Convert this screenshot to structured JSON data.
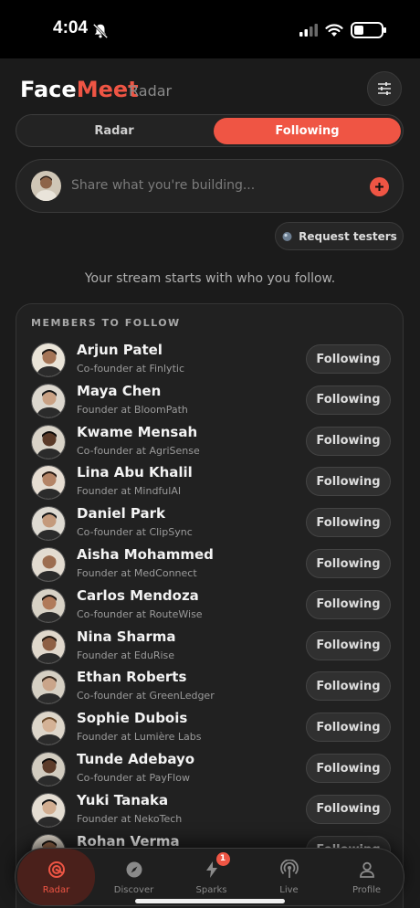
{
  "status_bar": {
    "time": "4:04"
  },
  "header": {
    "brand_face": "Face",
    "brand_meet": "Meet",
    "subtitle": "Radar"
  },
  "segment": {
    "tab_radar": "Radar",
    "tab_following": "Following"
  },
  "composer": {
    "placeholder": "Share what you're building..."
  },
  "request_testers": {
    "label": "Request testers"
  },
  "stream_note": "Your stream starts with who you follow.",
  "members_card": {
    "title": "MEMBERS TO FOLLOW",
    "members": [
      {
        "name": "Arjun Patel",
        "role": "Co-founder at Finlytic",
        "button": "Following"
      },
      {
        "name": "Maya Chen",
        "role": "Founder at BloomPath",
        "button": "Following"
      },
      {
        "name": "Kwame Mensah",
        "role": "Co-founder at AgriSense",
        "button": "Following"
      },
      {
        "name": "Lina Abu Khalil",
        "role": "Founder at MindfulAI",
        "button": "Following"
      },
      {
        "name": "Daniel Park",
        "role": "Co-founder at ClipSync",
        "button": "Following"
      },
      {
        "name": "Aisha Mohammed",
        "role": "Founder at MedConnect",
        "button": "Following"
      },
      {
        "name": "Carlos Mendoza",
        "role": "Co-founder at RouteWise",
        "button": "Following"
      },
      {
        "name": "Nina Sharma",
        "role": "Founder at EduRise",
        "button": "Following"
      },
      {
        "name": "Ethan Roberts",
        "role": "Co-founder at GreenLedger",
        "button": "Following"
      },
      {
        "name": "Sophie Dubois",
        "role": "Founder at Lumière Labs",
        "button": "Following"
      },
      {
        "name": "Tunde Adebayo",
        "role": "Co-founder at PayFlow",
        "button": "Following"
      },
      {
        "name": "Yuki Tanaka",
        "role": "Founder at NekoTech",
        "button": "Following"
      },
      {
        "name": "Rohan Verma",
        "role": "",
        "button": "Following"
      }
    ]
  },
  "tabbar": {
    "radar": "Radar",
    "discover": "Discover",
    "sparks": "Sparks",
    "sparks_badge": "1",
    "live": "Live",
    "profile": "Profile"
  },
  "colors": {
    "accent": "#ef5544",
    "background": "#1b1b1b",
    "card": "#212121"
  }
}
